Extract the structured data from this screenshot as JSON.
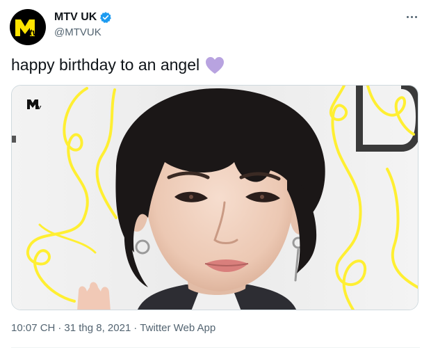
{
  "account": {
    "display_name": "MTV UK",
    "handle": "@MTVUK",
    "verified": true,
    "avatar_icon": "mtv-logo-icon"
  },
  "tweet": {
    "text": "happy birthday to an angel",
    "emoji": "purple-heart-icon",
    "media_watermark": "mtv-watermark-icon"
  },
  "meta": {
    "time": "10:07 CH",
    "date": "31 thg 8, 2021",
    "separator": "·",
    "source": "Twitter Web App"
  },
  "colors": {
    "verified_blue": "#1d9bf0",
    "heart_purple": "#b8a3e0",
    "accent_yellow": "#ffef32",
    "mtv_yellow": "#ffe400",
    "secondary_text": "#536471"
  }
}
